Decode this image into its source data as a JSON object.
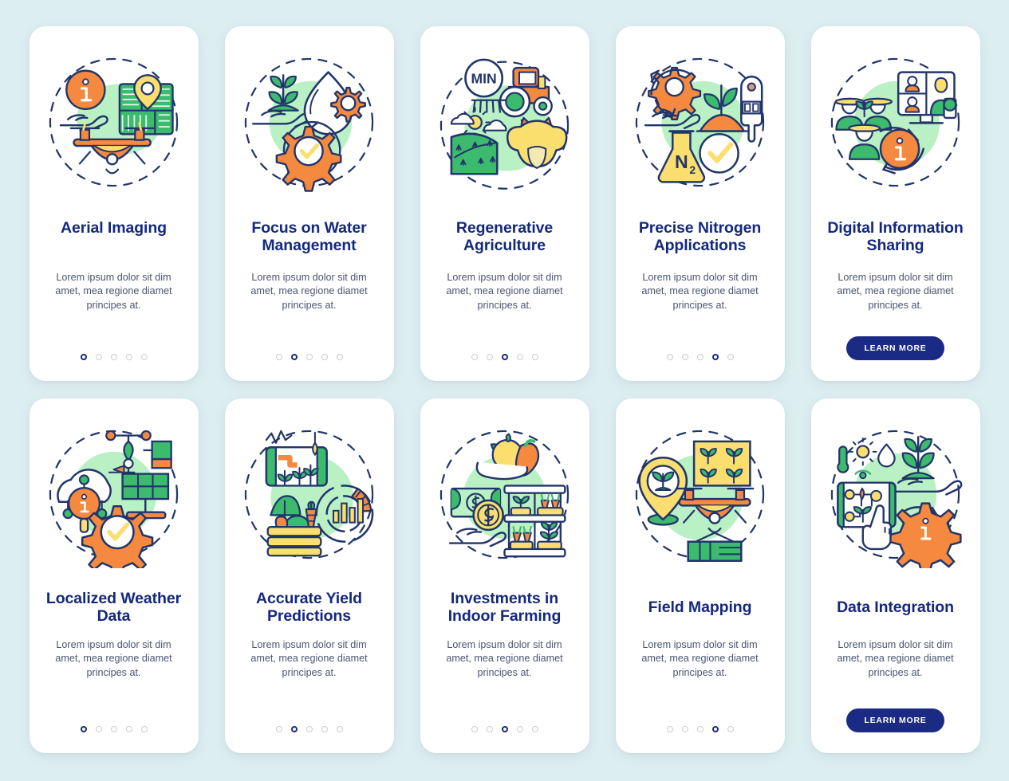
{
  "theme": {
    "background": "#ddeef1",
    "card_bg": "#ffffff",
    "title_color": "#14287e",
    "body_color": "#4b5572",
    "accent_orange": "#f5893f",
    "accent_green": "#3cba6e",
    "accent_light_green": "#b9f0c4",
    "accent_yellow": "#fadf6e",
    "stroke_navy": "#22356b",
    "dot_active": "#1b2a7a",
    "dot_inactive": "#c9ccd6",
    "button_bg": "#1a2a85",
    "button_text": "#ffffff"
  },
  "common": {
    "description": "Lorem ipsum dolor sit dim amet, mea regione diamet principes at.",
    "learn_more_label": "LEARN MORE",
    "dot_count": 5
  },
  "cards": [
    {
      "id": "aerial-imaging",
      "title": "Aerial Imaging",
      "description": "Lorem ipsum dolor sit dim amet, mea regione diamet principes at.",
      "active_dot": 1,
      "has_button": false,
      "icon_names": [
        "info-circle-icon",
        "map-pin-icon",
        "field-grid-icon",
        "hand-icon",
        "drone-icon"
      ]
    },
    {
      "id": "focus-on-water-management",
      "title": "Focus on Water Management",
      "description": "Lorem ipsum dolor sit dim amet, mea regione diamet principes at.",
      "active_dot": 2,
      "has_button": false,
      "icon_names": [
        "sprout-icon",
        "hand-icon",
        "water-drop-icon",
        "gear-icon",
        "gear-check-icon"
      ]
    },
    {
      "id": "regenerative-agriculture",
      "title": "Regenerative Agriculture",
      "description": "Lorem ipsum dolor sit dim amet, mea regione diamet principes at.",
      "active_dot": 3,
      "has_button": false,
      "badge_text": "MIN",
      "icon_names": [
        "min-badge-icon",
        "tractor-icon",
        "field-icon",
        "cow-icon",
        "sun-icon",
        "cloud-icon"
      ]
    },
    {
      "id": "precise-nitrogen-applications",
      "title": "Precise Nitrogen Applications",
      "description": "Lorem ipsum dolor sit dim amet, mea regione diamet principes at.",
      "active_dot": 4,
      "has_button": false,
      "badge_text": "N",
      "badge_subscript": "2",
      "icon_names": [
        "gear-icon",
        "hand-icon",
        "soil-sprout-icon",
        "soil-meter-icon",
        "flask-icon",
        "check-circle-icon"
      ]
    },
    {
      "id": "digital-information-sharing",
      "title": "Digital Information Sharing",
      "description": "Lorem ipsum dolor sit dim amet, mea regione diamet principes at.",
      "active_dot": 0,
      "has_button": true,
      "button_label": "LEARN MORE",
      "icon_names": [
        "farmers-group-icon",
        "video-call-screen-icon",
        "info-circle-icon",
        "refresh-arrow-icon"
      ]
    },
    {
      "id": "localized-weather-data",
      "title": "Localized Weather Data",
      "description": "Lorem ipsum dolor sit dim amet, mea regione diamet principes at.",
      "active_dot": 1,
      "has_button": false,
      "icon_names": [
        "cloud-info-icon",
        "weather-station-icon",
        "solar-panel-icon",
        "gear-check-icon"
      ]
    },
    {
      "id": "accurate-yield-predictions",
      "title": "Accurate Yield Predictions",
      "description": "Lorem ipsum dolor sit dim amet, mea regione diamet principes at.",
      "active_dot": 2,
      "has_button": false,
      "icon_names": [
        "tablet-plants-icon",
        "vegetable-basket-icon",
        "donut-chart-icon"
      ]
    },
    {
      "id": "investments-in-indoor-farming",
      "title": "Investments in Indoor Farming",
      "description": "Lorem ipsum dolor sit dim amet, mea regione diamet principes at.",
      "active_dot": 3,
      "has_button": false,
      "icon_names": [
        "produce-icon",
        "banknote-icon",
        "dollar-coin-icon",
        "hand-icon",
        "vertical-farm-shelf-icon"
      ]
    },
    {
      "id": "field-mapping",
      "title": "Field Mapping",
      "description": "Lorem ipsum dolor sit dim amet, mea regione diamet principes at.",
      "active_dot": 4,
      "has_button": false,
      "icon_names": [
        "map-pin-sprout-icon",
        "field-grid-icon",
        "drone-icon",
        "green-field-icon"
      ]
    },
    {
      "id": "data-integration",
      "title": "Data Integration",
      "description": "Lorem ipsum dolor sit dim amet, mea regione diamet principes at.",
      "active_dot": 0,
      "has_button": true,
      "button_label": "LEARN MORE",
      "icon_names": [
        "thermometer-icon",
        "sun-icon",
        "water-drop-icon",
        "tablet-icon",
        "hand-sprout-icon",
        "gear-info-icon"
      ]
    }
  ]
}
